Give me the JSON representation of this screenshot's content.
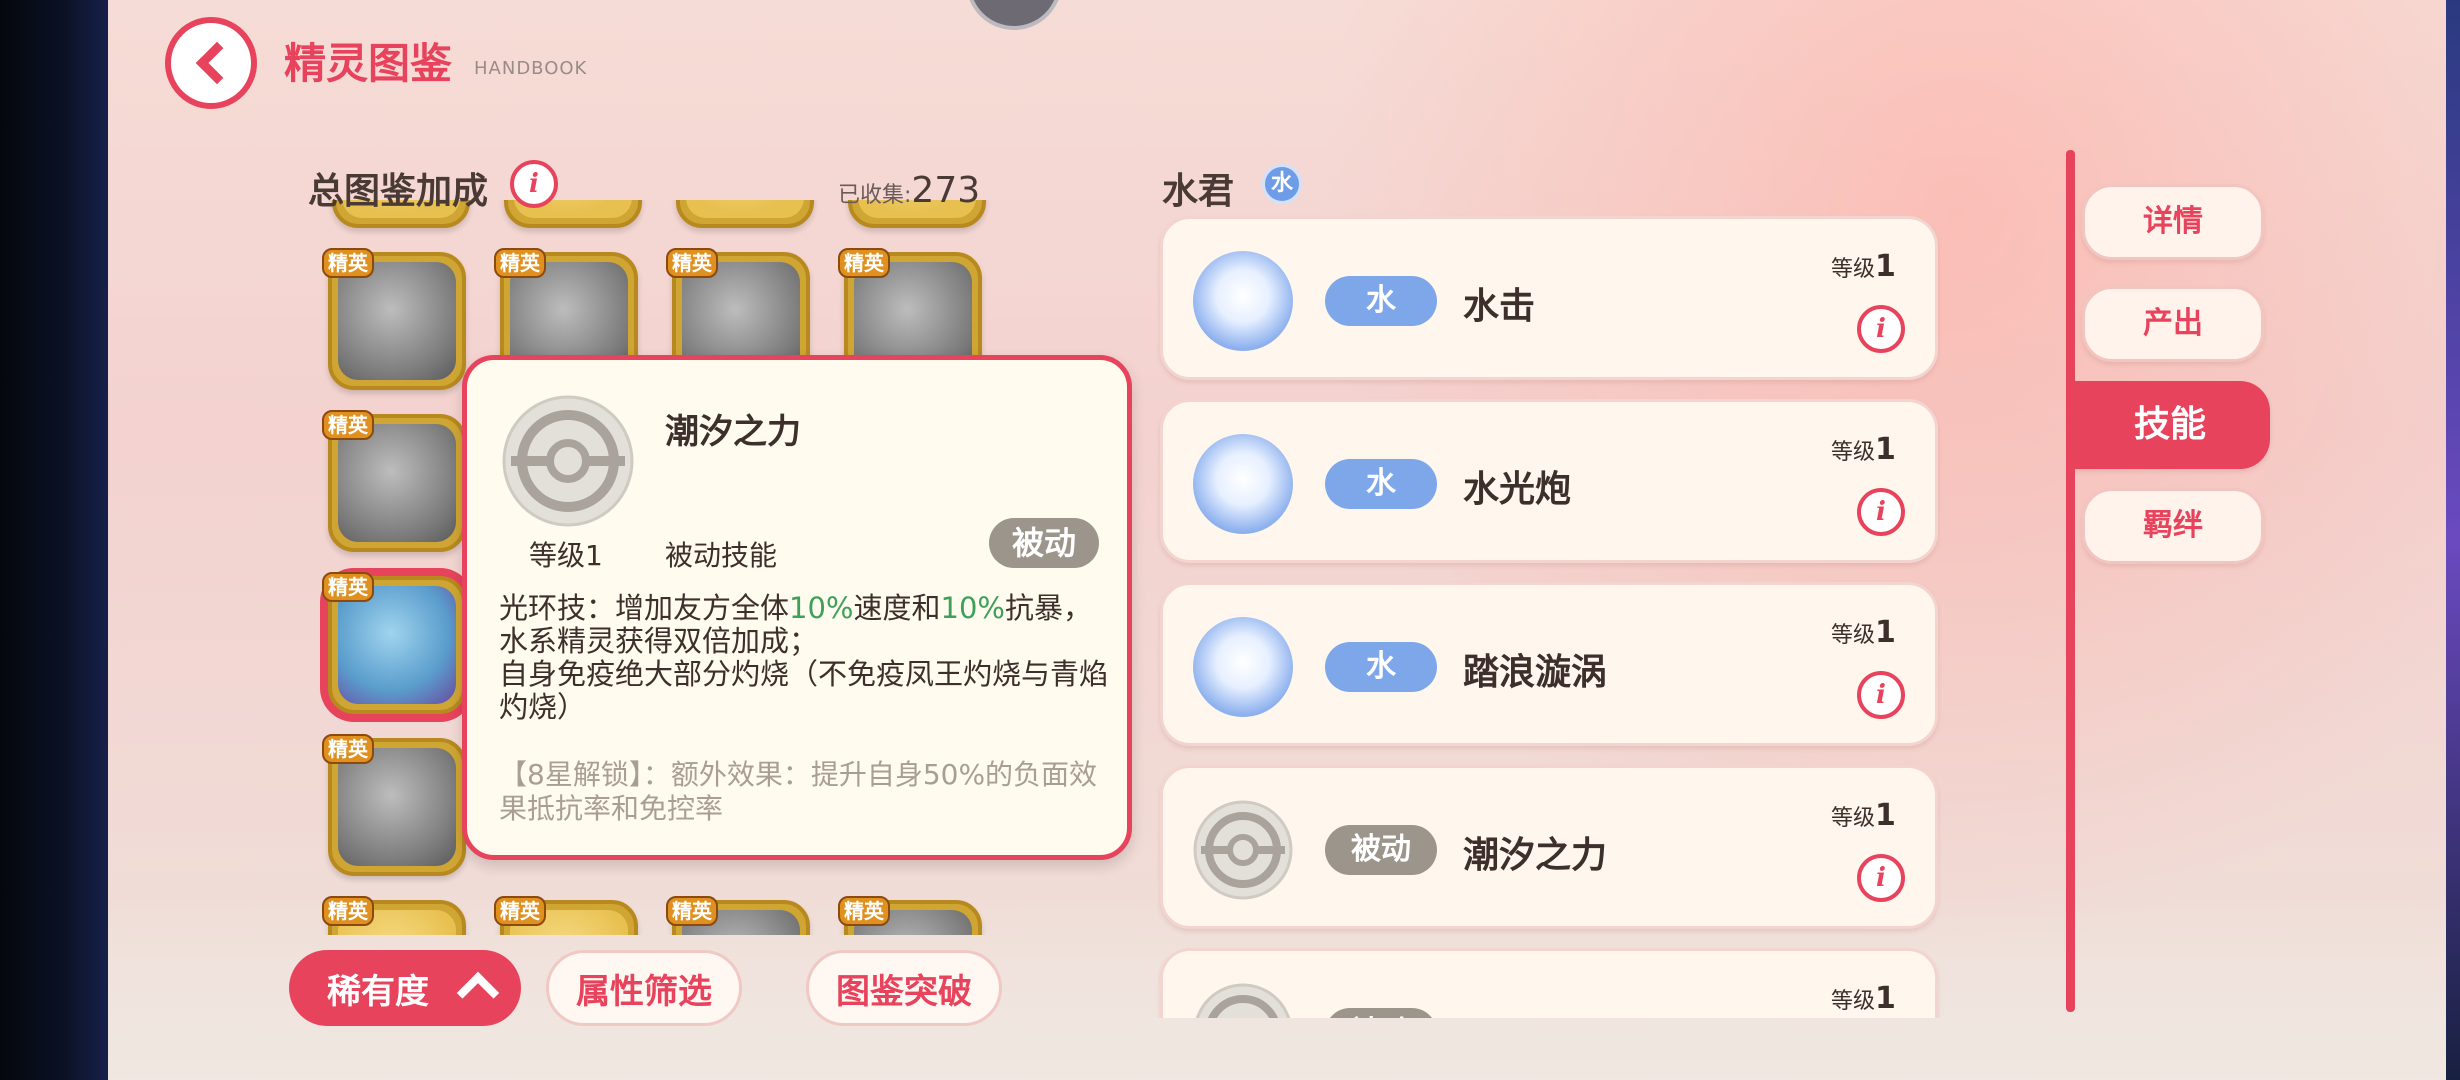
{
  "header": {
    "title": "精灵图鉴",
    "title_en": "HANDBOOK"
  },
  "left": {
    "section_title": "总图鉴加成",
    "collected_label": "已收集:",
    "collected_count": "273",
    "elite_label": "精英"
  },
  "popup": {
    "name": "潮汐之力",
    "level": "等级1",
    "type": "被动技能",
    "badge": "被动",
    "desc_1a": "光环技：增加友方全体",
    "desc_1b": "10%",
    "desc_1c": "速度和",
    "desc_1d": "10%",
    "desc_1e": "抗暴，",
    "desc_2": "水系精灵获得双倍加成；",
    "desc_3": "自身免疫绝大部分灼烧（不免疫凤王灼烧与青焰灼烧）",
    "lock": "【8星解锁】：额外效果：提升自身50%的负面效果抵抗率和免控率"
  },
  "buttons": {
    "rarity": "稀有度",
    "attr_filter": "属性筛选",
    "breakthrough": "图鉴突破"
  },
  "pet": {
    "name": "水君",
    "type": "水"
  },
  "skills": [
    {
      "tag": "水",
      "name": "水击",
      "level_label": "等级",
      "level": "1"
    },
    {
      "tag": "水",
      "name": "水光炮",
      "level_label": "等级",
      "level": "1"
    },
    {
      "tag": "水",
      "name": "踏浪漩涡",
      "level_label": "等级",
      "level": "1"
    },
    {
      "tag": "被动",
      "name": "潮汐之力",
      "level_label": "等级",
      "level": "1"
    },
    {
      "tag": "被动",
      "name": "",
      "level_label": "等级",
      "level": "1"
    }
  ],
  "tabs": {
    "detail": "详情",
    "output": "产出",
    "skills": "技能",
    "bond": "羁绊"
  },
  "colors": {
    "accent": "#e8435c",
    "water": "#7ea7ea",
    "passive": "#9c958c",
    "positive": "#3fa05a"
  }
}
